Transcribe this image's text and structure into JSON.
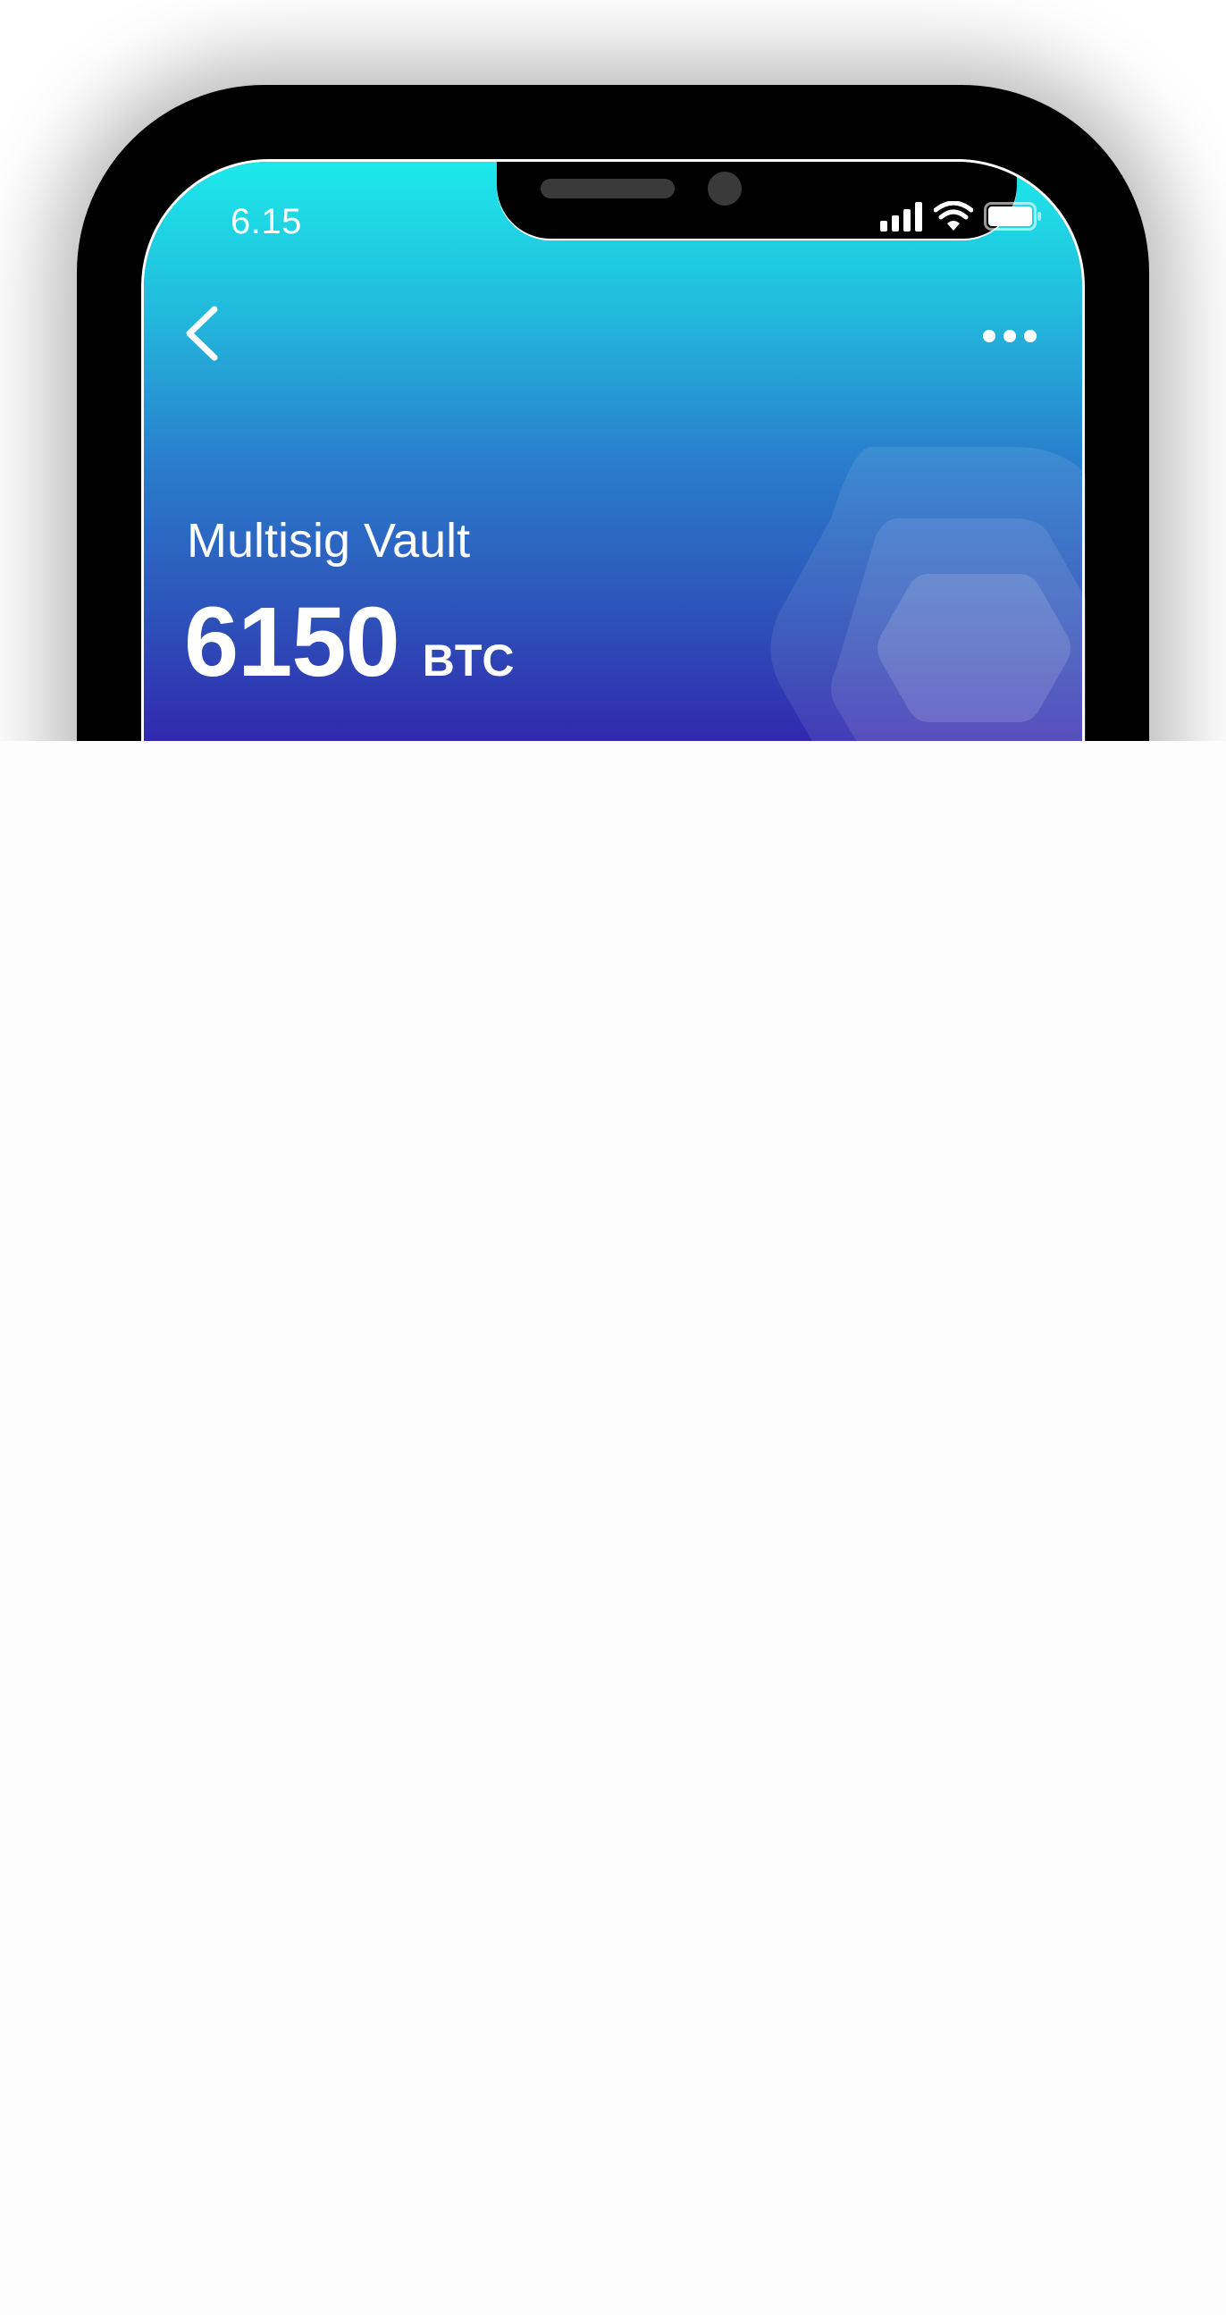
{
  "status_bar": {
    "time": "6.15",
    "icons": [
      "signal-icon",
      "wifi-icon",
      "battery-icon"
    ]
  },
  "nav": {
    "back_icon": "chevron-left-icon",
    "more_icon": "more-dots-icon"
  },
  "wallet": {
    "title": "Multisig Vault",
    "amount": "6150",
    "unit": "BTC"
  },
  "colors": {
    "gradient_top": "#1ce9ea",
    "gradient_bottom": "#3a00a2",
    "device": "#000000",
    "page_background": "#fdfdfd"
  }
}
